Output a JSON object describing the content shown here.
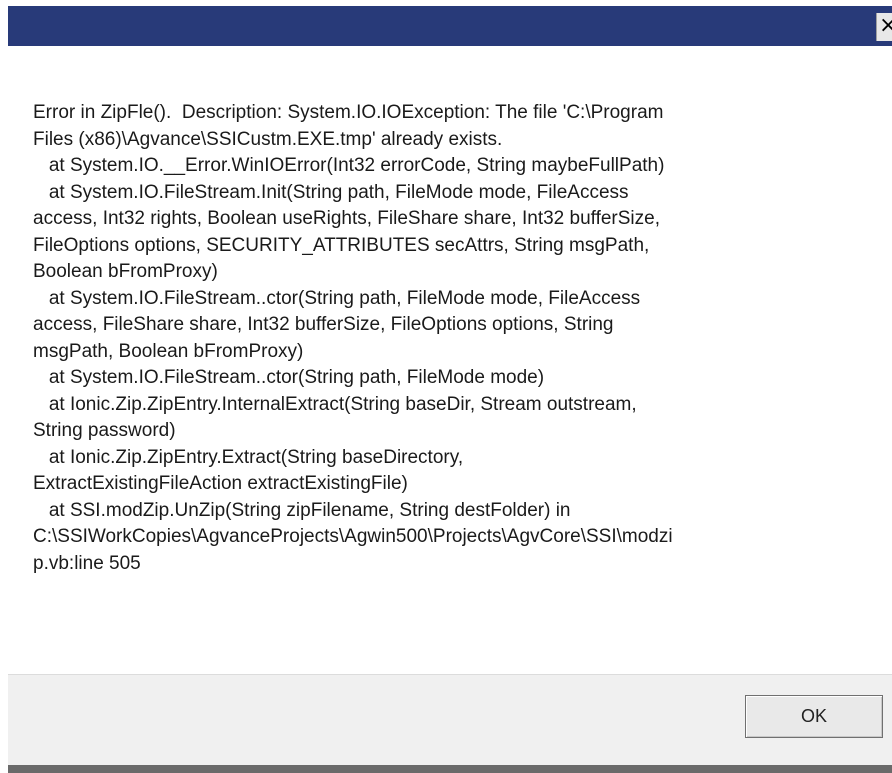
{
  "dialog": {
    "title": "",
    "close_glyph": "×",
    "message_lines": [
      "Error in ZipFle().  Description: System.IO.IOException: The file 'C:\\Program",
      "Files (x86)\\Agvance\\SSICustm.EXE.tmp' already exists.",
      "   at System.IO.__Error.WinIOError(Int32 errorCode, String maybeFullPath)",
      "   at System.IO.FileStream.Init(String path, FileMode mode, FileAccess",
      "access, Int32 rights, Boolean useRights, FileShare share, Int32 bufferSize,",
      "FileOptions options, SECURITY_ATTRIBUTES secAttrs, String msgPath,",
      "Boolean bFromProxy)",
      "   at System.IO.FileStream..ctor(String path, FileMode mode, FileAccess",
      "access, FileShare share, Int32 bufferSize, FileOptions options, String",
      "msgPath, Boolean bFromProxy)",
      "   at System.IO.FileStream..ctor(String path, FileMode mode)",
      "   at Ionic.Zip.ZipEntry.InternalExtract(String baseDir, Stream outstream,",
      "String password)",
      "   at Ionic.Zip.ZipEntry.Extract(String baseDirectory,",
      "ExtractExistingFileAction extractExistingFile)",
      "   at SSI.modZip.UnZip(String zipFilename, String destFolder) in",
      "C:\\SSIWorkCopies\\AgvanceProjects\\Agwin500\\Projects\\AgvCore\\SSI\\modzi",
      "p.vb:line 505"
    ],
    "ok_label": "OK"
  },
  "colors": {
    "titlebar": "#283a79",
    "background": "#ffffff",
    "footer": "#f0f0f0"
  },
  "icons": {
    "close": "close-icon"
  }
}
